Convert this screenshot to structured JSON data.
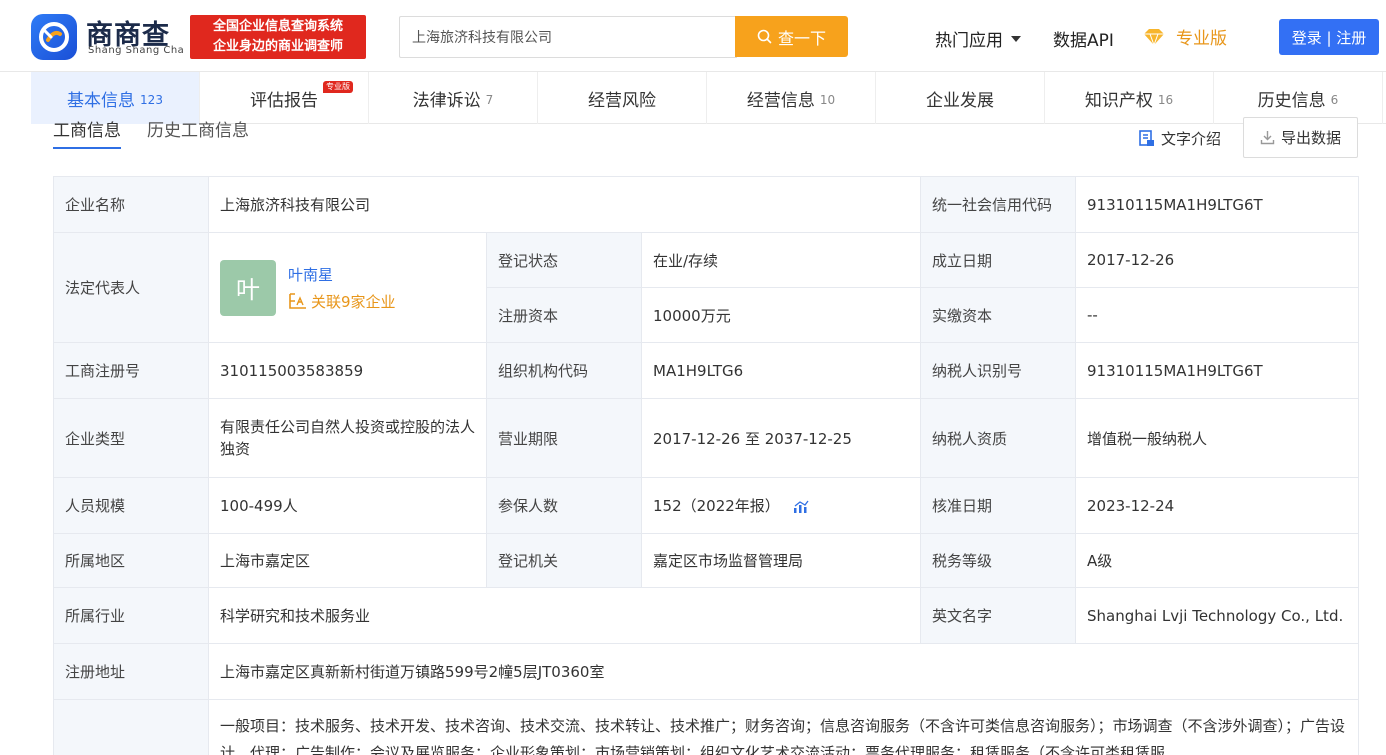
{
  "header": {
    "brand_name": "商商查",
    "brand_sub": "Shang Shang Cha",
    "slogan_line1": "全国企业信息查询系统",
    "slogan_line2": "企业身边的商业调查师",
    "search_value": "上海旅济科技有限公司",
    "search_button": "查一下",
    "nav_hot": "热门应用",
    "nav_api": "数据API",
    "nav_pro": "专业版",
    "login": "登录 | 注册"
  },
  "tabs": [
    {
      "label": "基本信息",
      "count": "123",
      "active": true
    },
    {
      "label": "评估报告",
      "count": "",
      "badge": "专业版"
    },
    {
      "label": "法律诉讼",
      "count": "7"
    },
    {
      "label": "经营风险",
      "count": ""
    },
    {
      "label": "经营信息",
      "count": "10"
    },
    {
      "label": "企业发展",
      "count": ""
    },
    {
      "label": "知识产权",
      "count": "16"
    },
    {
      "label": "历史信息",
      "count": "6"
    }
  ],
  "subtabs": [
    "工商信息",
    "历史工商信息"
  ],
  "text_intro": "文字介绍",
  "export": "导出数据",
  "info": {
    "company_name_label": "企业名称",
    "company_name": "上海旅济科技有限公司",
    "credit_code_label": "统一社会信用代码",
    "credit_code": "91310115MA1H9LTG6T",
    "legal_rep_label": "法定代表人",
    "legal_rep_avatar": "叶",
    "legal_rep_name": "叶南星",
    "legal_rep_related": "关联9家企业",
    "reg_status_label": "登记状态",
    "reg_status": "在业/存续",
    "founded_label": "成立日期",
    "founded": "2017-12-26",
    "reg_capital_label": "注册资本",
    "reg_capital": "10000万元",
    "paid_capital_label": "实缴资本",
    "paid_capital": "--",
    "reg_no_label": "工商注册号",
    "reg_no": "310115003583859",
    "org_code_label": "组织机构代码",
    "org_code": "MA1H9LTG6",
    "taxpayer_id_label": "纳税人识别号",
    "taxpayer_id": "91310115MA1H9LTG6T",
    "type_label": "企业类型",
    "type": "有限责任公司自然人投资或控股的法人独资",
    "term_label": "营业期限",
    "term": "2017-12-26 至 2037-12-25",
    "tax_qual_label": "纳税人资质",
    "tax_qual": "增值税一般纳税人",
    "staff_label": "人员规模",
    "staff": "100-499人",
    "insured_label": "参保人数",
    "insured": "152（2022年报）",
    "approved_label": "核准日期",
    "approved": "2023-12-24",
    "region_label": "所属地区",
    "region": "上海市嘉定区",
    "authority_label": "登记机关",
    "authority": "嘉定区市场监督管理局",
    "tax_grade_label": "税务等级",
    "tax_grade": "A级",
    "industry_label": "所属行业",
    "industry": "科学研究和技术服务业",
    "english_label": "英文名字",
    "english": "Shanghai Lvji Technology Co., Ltd.",
    "address_label": "注册地址",
    "address": "上海市嘉定区真新新村街道万镇路599号2幢5层JT0360室",
    "scope_text": "一般项目：技术服务、技术开发、技术咨询、技术交流、技术转让、技术推广；财务咨询；信息咨询服务（不含许可类信息咨询服务）；市场调查（不含涉外调查）；广告设计、代理；广告制作；会议及展览服务；企业形象策划；市场营销策划；组织文化艺术交流活动；票务代理服务；租赁服务（不含许可类租赁服"
  },
  "colors": {
    "accent": "#2f6fe4",
    "orange": "#f7a21c",
    "red": "#e0281e"
  }
}
